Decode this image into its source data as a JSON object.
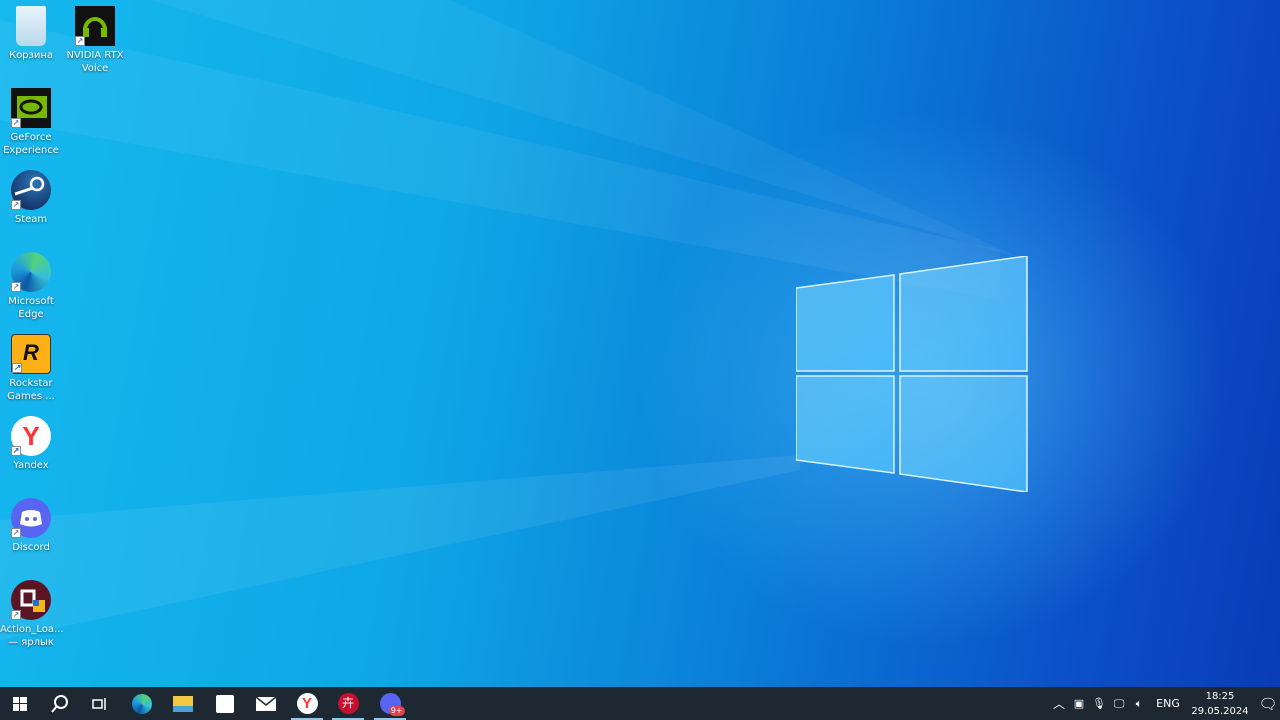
{
  "desktop_icons": [
    {
      "label": "Корзина",
      "icon": "recycle-bin-icon"
    },
    {
      "label": "NVIDIA RTX Voice",
      "icon": "nvidia-rtx-voice-icon"
    },
    {
      "label": "GeForce Experience",
      "icon": "geforce-experience-icon"
    },
    {
      "label": "Steam",
      "icon": "steam-icon"
    },
    {
      "label": "Microsoft Edge",
      "icon": "edge-icon"
    },
    {
      "label": "Rockstar Games ...",
      "icon": "rockstar-icon"
    },
    {
      "label": "Yandex",
      "icon": "yandex-icon"
    },
    {
      "label": "Discord",
      "icon": "discord-icon"
    },
    {
      "label": "Action_Loa... — ярлык",
      "icon": "action-loader-icon"
    }
  ],
  "taskbar": {
    "apps": [
      "start",
      "search",
      "task-view",
      "edge",
      "file-explorer",
      "store",
      "mail",
      "yandex",
      "app-red",
      "discord"
    ],
    "discord_badge": "9+",
    "tray": {
      "language": "ENG",
      "time": "18:25",
      "date": "29.05.2024"
    }
  },
  "colors": {
    "taskbar": "#1d2833",
    "accent": "#8cc8f0"
  }
}
